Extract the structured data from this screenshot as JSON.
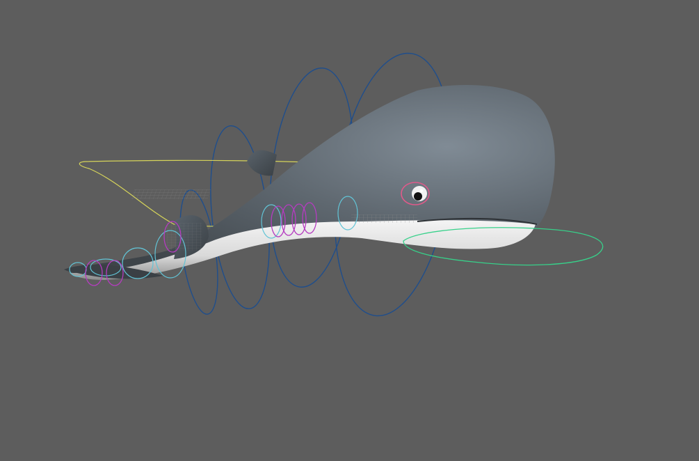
{
  "viewport": {
    "background_color": "#5d5d5d",
    "model": "whale"
  },
  "colors": {
    "body_dark": "#4a5157",
    "body_light": "#75808a",
    "belly": "#e8e8e8",
    "belly_shadow": "#9a9a9a",
    "control_blue": "#1f4e8c",
    "control_cyan": "#62c4d6",
    "control_magenta": "#b53cc0",
    "control_yellow": "#d6d45a",
    "control_green": "#37d18a",
    "eye_ring": "#e05a8a",
    "eye_white": "#f2f2f2",
    "eye_pupil": "#111111"
  },
  "controls": [
    {
      "name": "spine-control",
      "icon": "circle-curve",
      "color": "control_blue"
    },
    {
      "name": "tail-fk-control",
      "icon": "circle-curve",
      "color": "control_cyan"
    },
    {
      "name": "tail-ik-control",
      "icon": "circle-curve",
      "color": "control_magenta"
    },
    {
      "name": "root-control",
      "icon": "loop-curve",
      "color": "control_yellow"
    },
    {
      "name": "jaw-control",
      "icon": "loop-curve",
      "color": "control_green"
    },
    {
      "name": "eye-control",
      "icon": "circle-curve",
      "color": "eye_ring"
    }
  ]
}
